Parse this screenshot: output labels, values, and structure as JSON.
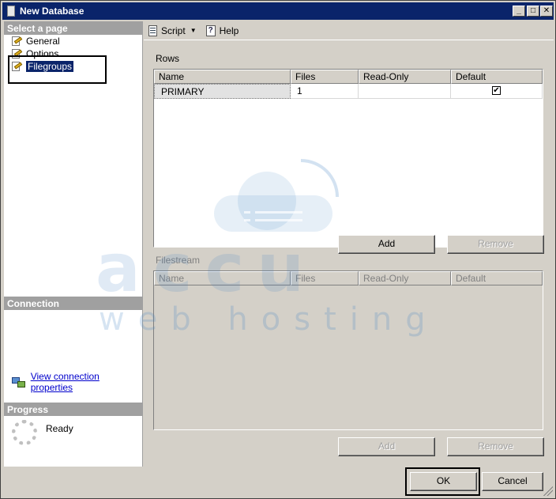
{
  "window": {
    "title": "New Database"
  },
  "left": {
    "select_page_header": "Select a page",
    "pages": [
      {
        "label": "General",
        "icon": "wrench-page-icon",
        "selected": false
      },
      {
        "label": "Options",
        "icon": "wrench-page-icon",
        "selected": false
      },
      {
        "label": "Filegroups",
        "icon": "wrench-page-icon",
        "selected": true
      }
    ],
    "connection_header": "Connection",
    "connection_link": "View connection properties",
    "progress_header": "Progress",
    "progress_status": "Ready"
  },
  "toolbar": {
    "script_label": "Script",
    "help_label": "Help"
  },
  "rows_section": {
    "label": "Rows",
    "columns": [
      "Name",
      "Files",
      "Read-Only",
      "Default"
    ],
    "rows": [
      {
        "name": "PRIMARY",
        "files": "1",
        "read_only": "",
        "default_checked": true,
        "check_glyph": "✔"
      }
    ],
    "add_label": "Add",
    "remove_label": "Remove"
  },
  "filestream_section": {
    "label": "Filestream",
    "columns": [
      "Name",
      "Files",
      "Read-Only",
      "Default"
    ],
    "add_label": "Add",
    "remove_label": "Remove"
  },
  "footer": {
    "ok_label": "OK",
    "cancel_label": "Cancel"
  },
  "watermark": {
    "brand": "accu",
    "tagline": "web hosting"
  },
  "colors": {
    "titlebar": "#0a246a",
    "panel": "#d4d0c8",
    "section_header": "#a0a0a0",
    "link": "#0000cc"
  }
}
